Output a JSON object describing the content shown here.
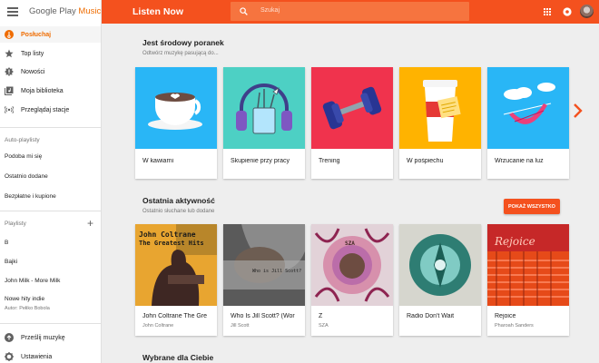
{
  "brand": {
    "name_plain": "Google Play",
    "name_accent": "Music"
  },
  "topbar": {
    "title": "Listen Now",
    "search_placeholder": "Szukaj",
    "accent_color": "#f4511e"
  },
  "sidebar": {
    "main_items": [
      {
        "label": "Posłuchaj",
        "icon": "listen-now-icon",
        "active": true
      },
      {
        "label": "Top listy",
        "icon": "star-icon"
      },
      {
        "label": "Nowości",
        "icon": "new-releases-icon"
      },
      {
        "label": "Moja biblioteka",
        "icon": "library-icon"
      },
      {
        "label": "Przeglądaj stacje",
        "icon": "radio-icon"
      }
    ],
    "autoplaylists_header": "Auto-playlisty",
    "autoplaylists": [
      "Podoba mi się",
      "Ostatnio dodane",
      "Bezpłatne i kupione"
    ],
    "playlists_header": "Playlisty",
    "playlists": [
      {
        "label": "B"
      },
      {
        "label": "Bajki"
      },
      {
        "label": "John Milk - More Milk"
      },
      {
        "label": "Nowe hity indie",
        "author": "Autor: Pełiko Bobola"
      }
    ],
    "bottom_items": [
      {
        "label": "Prześlij muzykę",
        "icon": "upload-icon"
      },
      {
        "label": "Ustawienia",
        "icon": "settings-icon"
      }
    ]
  },
  "sections": {
    "mood": {
      "title": "Jest środowy poranek",
      "subtitle": "Odtwórz muzykę pasującą do...",
      "cards": [
        {
          "title": "W kawiarni",
          "color": "#29b6f6",
          "icon": "coffee-cup-icon"
        },
        {
          "title": "Skupienie przy pracy",
          "color": "#4dd0c4",
          "icon": "headphones-icon"
        },
        {
          "title": "Trening",
          "color": "#f0334d",
          "icon": "dumbbell-icon"
        },
        {
          "title": "W pośpiechu",
          "color": "#ffb300",
          "icon": "takeaway-cup-icon"
        },
        {
          "title": "Wrzucanie na luz",
          "color": "#29b6f6",
          "icon": "hammock-icon"
        }
      ]
    },
    "recent": {
      "title": "Ostatnia aktywność",
      "subtitle": "Ostatnio słuchane lub dodane",
      "show_all": "POKAŻ WSZYSTKO",
      "cards": [
        {
          "title": "John Coltrane The Gre",
          "artist": "John Coltrane",
          "cover_line1": "John Coltrane",
          "cover_line2": "The Greatest Hits"
        },
        {
          "title": "Who Is Jill Scott? (Wor",
          "artist": "Jill Scott",
          "cover_text": "Who is Jill Scott?"
        },
        {
          "title": "Z",
          "artist": "SZA",
          "cover_text": "SZA"
        },
        {
          "title": "Radio Don't Wait",
          "artist": ""
        },
        {
          "title": "Rejoice",
          "artist": "Pharoah Sanders",
          "cover_text": "Rejoice"
        }
      ]
    },
    "for_you": {
      "title": "Wybrane dla Ciebie"
    }
  }
}
